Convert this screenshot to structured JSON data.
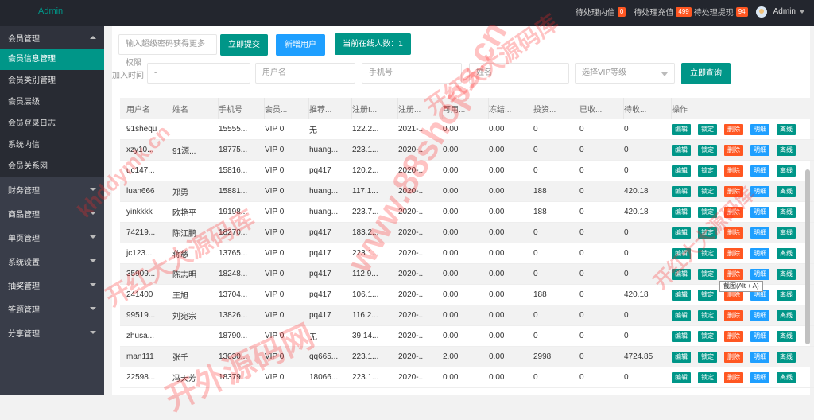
{
  "topbar": {
    "brand": "Admin",
    "pending_messages_label": "待处理内信",
    "pending_messages_count": "0",
    "pending_recharge_label": "待处理充值",
    "pending_recharge_count": "499",
    "pending_withdraw_label": "待处理提现",
    "pending_withdraw_count": "94",
    "user": "Admin"
  },
  "sidebar": {
    "member_group": "会员管理",
    "member_items": [
      "会员信息管理",
      "会员类别管理",
      "会员层级",
      "会员登录日志",
      "系统内信",
      "会员关系网"
    ],
    "groups": [
      "财务管理",
      "商品管理",
      "单页管理",
      "系统设置",
      "抽奖管理",
      "答题管理",
      "分享管理"
    ]
  },
  "toolbar": {
    "password_placeholder": "输入超级密码获得更多权限",
    "submit_label": "立即提交",
    "add_user_label": "新增用户",
    "online_label": "当前在线人数：1"
  },
  "filters": {
    "join_time_label": "加入时间",
    "join_time_value": "-",
    "username_placeholder": "用户名",
    "phone_placeholder": "手机号",
    "name_placeholder": "姓名",
    "vip_placeholder": "选择VIP等级",
    "query_label": "立即查询"
  },
  "table": {
    "columns": [
      "用户名",
      "姓名",
      "手机号",
      "会员...",
      "推荐...",
      "注册I...",
      "注册...",
      "可用...",
      "冻结...",
      "投资...",
      "已收...",
      "待收...",
      "操作"
    ],
    "actions": [
      "编辑",
      "锁定",
      "删除",
      "明细",
      "离线"
    ],
    "rows": [
      [
        "91shequ",
        "",
        "15555...",
        "VIP 0",
        "无",
        "122.2...",
        "2021-...",
        "0.00",
        "0.00",
        "0",
        "0",
        "0"
      ],
      [
        "xzy10...",
        "91源...",
        "18775...",
        "VIP 0",
        "huang...",
        "223.1...",
        "2020-...",
        "0.00",
        "0.00",
        "0",
        "0",
        "0"
      ],
      [
        "uc147...",
        "",
        "15816...",
        "VIP 0",
        "pq417",
        "120.2...",
        "2020-...",
        "0.00",
        "0.00",
        "0",
        "0",
        "0"
      ],
      [
        "luan666",
        "郑勇",
        "15881...",
        "VIP 0",
        "huang...",
        "117.1...",
        "2020-...",
        "0.00",
        "0.00",
        "188",
        "0",
        "420.18"
      ],
      [
        "yinkkkk",
        "欧艳平",
        "19198...",
        "VIP 0",
        "huang...",
        "223.7...",
        "2020-...",
        "0.00",
        "0.00",
        "188",
        "0",
        "420.18"
      ],
      [
        "74219...",
        "陈江鹏",
        "18270...",
        "VIP 0",
        "pq417",
        "183.2...",
        "2020-...",
        "0.00",
        "0.00",
        "0",
        "0",
        "0"
      ],
      [
        "jc123...",
        "蒋慈",
        "13765...",
        "VIP 0",
        "pq417",
        "223.1...",
        "2020-...",
        "0.00",
        "0.00",
        "0",
        "0",
        "0"
      ],
      [
        "35909...",
        "陈志明",
        "18248...",
        "VIP 0",
        "pq417",
        "112.9...",
        "2020-...",
        "0.00",
        "0.00",
        "0",
        "0",
        "0"
      ],
      [
        "241400",
        "王旭",
        "13704...",
        "VIP 0",
        "pq417",
        "106.1...",
        "2020-...",
        "0.00",
        "0.00",
        "188",
        "0",
        "420.18"
      ],
      [
        "99519...",
        "刘宛宗",
        "13826...",
        "VIP 0",
        "pq417",
        "116.2...",
        "2020-...",
        "0.00",
        "0.00",
        "0",
        "0",
        "0"
      ],
      [
        "zhusa...",
        "",
        "18790...",
        "VIP 0",
        "无",
        "39.14...",
        "2020-...",
        "0.00",
        "0.00",
        "0",
        "0",
        "0"
      ],
      [
        "man111",
        "张千",
        "13030...",
        "VIP 0",
        "qq665...",
        "223.1...",
        "2020-...",
        "2.00",
        "0.00",
        "2998",
        "0",
        "4724.85"
      ],
      [
        "22598...",
        "冯天芳",
        "18379...",
        "VIP 0",
        "18066...",
        "223.1...",
        "2020-...",
        "0.00",
        "0.00",
        "0",
        "0",
        "0"
      ]
    ]
  },
  "tooltip": "截图(Alt + A)",
  "watermarks": [
    "开红大大源码库",
    "khddymk.cn",
    "www.88shops.cn",
    "开外源码网"
  ]
}
